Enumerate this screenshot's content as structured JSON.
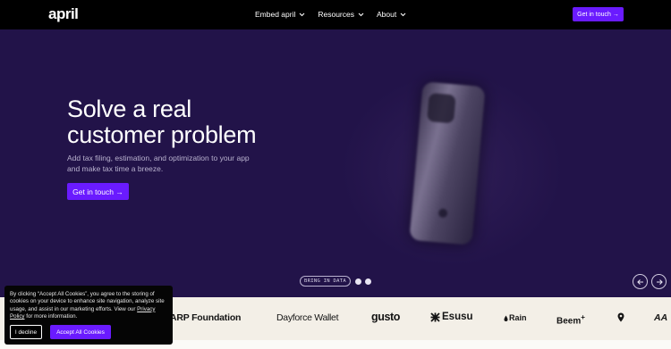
{
  "nav": {
    "logo": "april",
    "links": [
      "Embed april",
      "Resources",
      "About"
    ],
    "cta": "Get in touch →"
  },
  "hero": {
    "headline_line1": "Solve a real",
    "headline_line2": "customer problem",
    "subtext": "Add tax filing, estimation, and optimization to your app and make tax time a breeze.",
    "cta": "Get in touch →",
    "pill": "BRING IN DATA"
  },
  "partners": [
    "ARP Foundation",
    "Dayforce Wallet",
    "gusto",
    "Esusu",
    "Rain",
    "Beem",
    "AA"
  ],
  "cookie": {
    "text_before_link": "By clicking “Accept All Cookies”, you agree to the storing of cookies on your device to enhance site navigation, analyze site usage, and assist in our marketing efforts. View our ",
    "link": "Privacy Policy",
    "text_after_link": " for more information.",
    "decline": "I decline",
    "accept": "Accept All Cookies"
  },
  "colors": {
    "accent": "#6a1bff",
    "hero_bg": "#221349",
    "nav_bg": "#000000",
    "strip_bg": "#f3efe7"
  }
}
